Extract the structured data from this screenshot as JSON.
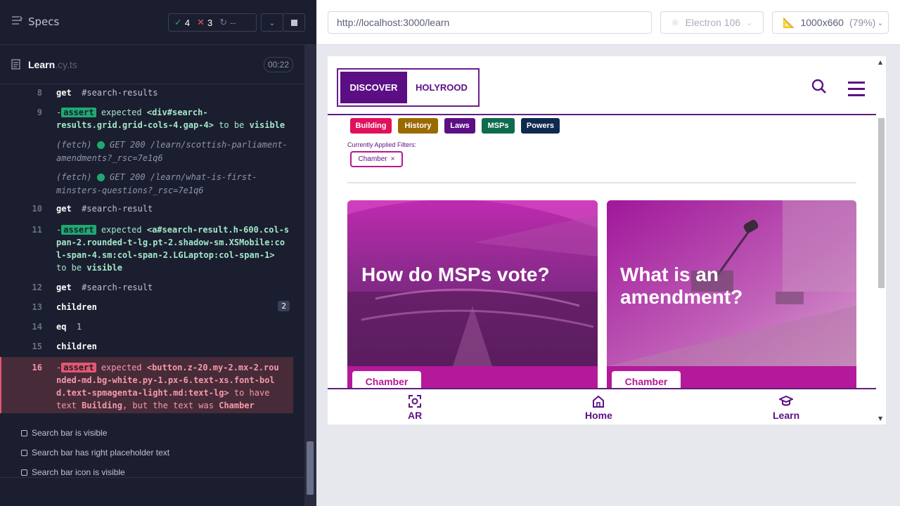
{
  "runner": {
    "specs_label": "Specs",
    "stats": {
      "passed": "4",
      "failed": "3",
      "pending": "--"
    },
    "file": {
      "name": "Learn",
      "ext": ".cy.ts",
      "time": "00:22"
    },
    "commands": [
      {
        "line": "8",
        "cmd": "get",
        "arg": "#search-results"
      },
      {
        "line": "9",
        "prefix": "-",
        "cmd": "assert",
        "text1": "expected",
        "el": "<div#search-results.grid.grid-cols-4.gap-4>",
        "text2": "to be",
        "tail": "visible"
      },
      {
        "xhr_label": "(fetch)",
        "xhr_text": "GET 200 /learn/scottish-parliament-amendments?_rsc=7e1q6"
      },
      {
        "xhr_label": "(fetch)",
        "xhr_text": "GET 200 /learn/what-is-first-minsters-questions?_rsc=7e1q6"
      },
      {
        "line": "10",
        "cmd": "get",
        "arg": "#search-result"
      },
      {
        "line": "11",
        "prefix": "-",
        "cmd": "assert",
        "text1": "expected",
        "el": "<a#search-result.h-600.col-span-2.rounded-t-lg.pt-2.shadow-sm.XSMobile:col-span-4.sm:col-span-2.LGLaptop:col-span-1>",
        "text2": "to be",
        "tail": "visible"
      },
      {
        "line": "12",
        "cmd": "get",
        "arg": "#search-result"
      },
      {
        "line": "13",
        "cmd": "children",
        "badge": "2"
      },
      {
        "line": "14",
        "cmd": "eq",
        "arg": "1"
      },
      {
        "line": "15",
        "cmd": "children"
      },
      {
        "line": "16",
        "prefix": "-",
        "cmd": "assert",
        "text1": "expected",
        "el": "<button.z-20.my-2.mx-2.rounded-md.bg-white.py-1.px-6.text-xs.font-bold.text-spmagenta-light.md:text-lg>",
        "text2": "to have text",
        "q1": "Building",
        "text3": ", but the text was",
        "q2": "Chamber"
      }
    ],
    "tests": [
      "Search bar is visible",
      "Search bar has right placeholder text",
      "Search bar icon is visible"
    ]
  },
  "browser": {
    "url": "http://localhost:3000/learn",
    "engine": "Electron 106",
    "viewport": "1000x660",
    "zoom": "(79%)"
  },
  "site": {
    "logo_left": "DISCOVER",
    "logo_right": "HOLYROOD",
    "chips": [
      {
        "label": "Building",
        "color": "#e0105a"
      },
      {
        "label": "History",
        "color": "#9a6a00"
      },
      {
        "label": "Laws",
        "color": "#5c0f85"
      },
      {
        "label": "MSPs",
        "color": "#0e6b4e"
      },
      {
        "label": "Powers",
        "color": "#0e2a4f"
      }
    ],
    "filters_label": "Currently Applied Filters:",
    "applied_filter": "Chamber",
    "applied_filter_close": "×",
    "cards": [
      {
        "title": "How do MSPs vote?",
        "tag": "Chamber"
      },
      {
        "title": "What is an amendment?",
        "tag": "Chamber"
      }
    ],
    "nav": [
      {
        "label": "AR",
        "icon": "ar-scan-icon"
      },
      {
        "label": "Home",
        "icon": "home-icon"
      },
      {
        "label": "Learn",
        "icon": "graduation-cap-icon"
      }
    ]
  }
}
